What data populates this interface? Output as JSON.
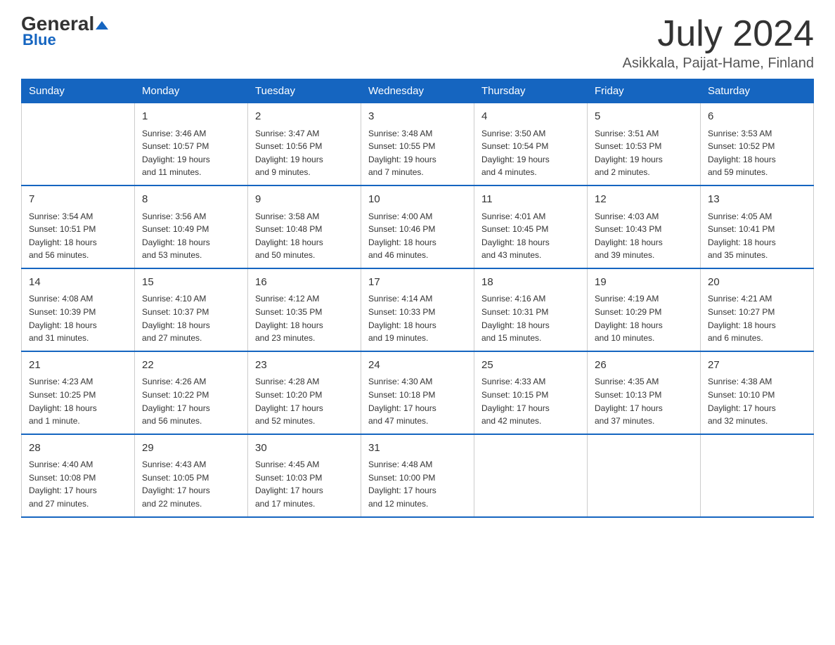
{
  "header": {
    "logo_general": "General",
    "logo_blue": "Blue",
    "month_year": "July 2024",
    "location": "Asikkala, Paijat-Hame, Finland"
  },
  "days_of_week": [
    "Sunday",
    "Monday",
    "Tuesday",
    "Wednesday",
    "Thursday",
    "Friday",
    "Saturday"
  ],
  "weeks": [
    {
      "days": [
        {
          "num": "",
          "info": ""
        },
        {
          "num": "1",
          "info": "Sunrise: 3:46 AM\nSunset: 10:57 PM\nDaylight: 19 hours\nand 11 minutes."
        },
        {
          "num": "2",
          "info": "Sunrise: 3:47 AM\nSunset: 10:56 PM\nDaylight: 19 hours\nand 9 minutes."
        },
        {
          "num": "3",
          "info": "Sunrise: 3:48 AM\nSunset: 10:55 PM\nDaylight: 19 hours\nand 7 minutes."
        },
        {
          "num": "4",
          "info": "Sunrise: 3:50 AM\nSunset: 10:54 PM\nDaylight: 19 hours\nand 4 minutes."
        },
        {
          "num": "5",
          "info": "Sunrise: 3:51 AM\nSunset: 10:53 PM\nDaylight: 19 hours\nand 2 minutes."
        },
        {
          "num": "6",
          "info": "Sunrise: 3:53 AM\nSunset: 10:52 PM\nDaylight: 18 hours\nand 59 minutes."
        }
      ]
    },
    {
      "days": [
        {
          "num": "7",
          "info": "Sunrise: 3:54 AM\nSunset: 10:51 PM\nDaylight: 18 hours\nand 56 minutes."
        },
        {
          "num": "8",
          "info": "Sunrise: 3:56 AM\nSunset: 10:49 PM\nDaylight: 18 hours\nand 53 minutes."
        },
        {
          "num": "9",
          "info": "Sunrise: 3:58 AM\nSunset: 10:48 PM\nDaylight: 18 hours\nand 50 minutes."
        },
        {
          "num": "10",
          "info": "Sunrise: 4:00 AM\nSunset: 10:46 PM\nDaylight: 18 hours\nand 46 minutes."
        },
        {
          "num": "11",
          "info": "Sunrise: 4:01 AM\nSunset: 10:45 PM\nDaylight: 18 hours\nand 43 minutes."
        },
        {
          "num": "12",
          "info": "Sunrise: 4:03 AM\nSunset: 10:43 PM\nDaylight: 18 hours\nand 39 minutes."
        },
        {
          "num": "13",
          "info": "Sunrise: 4:05 AM\nSunset: 10:41 PM\nDaylight: 18 hours\nand 35 minutes."
        }
      ]
    },
    {
      "days": [
        {
          "num": "14",
          "info": "Sunrise: 4:08 AM\nSunset: 10:39 PM\nDaylight: 18 hours\nand 31 minutes."
        },
        {
          "num": "15",
          "info": "Sunrise: 4:10 AM\nSunset: 10:37 PM\nDaylight: 18 hours\nand 27 minutes."
        },
        {
          "num": "16",
          "info": "Sunrise: 4:12 AM\nSunset: 10:35 PM\nDaylight: 18 hours\nand 23 minutes."
        },
        {
          "num": "17",
          "info": "Sunrise: 4:14 AM\nSunset: 10:33 PM\nDaylight: 18 hours\nand 19 minutes."
        },
        {
          "num": "18",
          "info": "Sunrise: 4:16 AM\nSunset: 10:31 PM\nDaylight: 18 hours\nand 15 minutes."
        },
        {
          "num": "19",
          "info": "Sunrise: 4:19 AM\nSunset: 10:29 PM\nDaylight: 18 hours\nand 10 minutes."
        },
        {
          "num": "20",
          "info": "Sunrise: 4:21 AM\nSunset: 10:27 PM\nDaylight: 18 hours\nand 6 minutes."
        }
      ]
    },
    {
      "days": [
        {
          "num": "21",
          "info": "Sunrise: 4:23 AM\nSunset: 10:25 PM\nDaylight: 18 hours\nand 1 minute."
        },
        {
          "num": "22",
          "info": "Sunrise: 4:26 AM\nSunset: 10:22 PM\nDaylight: 17 hours\nand 56 minutes."
        },
        {
          "num": "23",
          "info": "Sunrise: 4:28 AM\nSunset: 10:20 PM\nDaylight: 17 hours\nand 52 minutes."
        },
        {
          "num": "24",
          "info": "Sunrise: 4:30 AM\nSunset: 10:18 PM\nDaylight: 17 hours\nand 47 minutes."
        },
        {
          "num": "25",
          "info": "Sunrise: 4:33 AM\nSunset: 10:15 PM\nDaylight: 17 hours\nand 42 minutes."
        },
        {
          "num": "26",
          "info": "Sunrise: 4:35 AM\nSunset: 10:13 PM\nDaylight: 17 hours\nand 37 minutes."
        },
        {
          "num": "27",
          "info": "Sunrise: 4:38 AM\nSunset: 10:10 PM\nDaylight: 17 hours\nand 32 minutes."
        }
      ]
    },
    {
      "days": [
        {
          "num": "28",
          "info": "Sunrise: 4:40 AM\nSunset: 10:08 PM\nDaylight: 17 hours\nand 27 minutes."
        },
        {
          "num": "29",
          "info": "Sunrise: 4:43 AM\nSunset: 10:05 PM\nDaylight: 17 hours\nand 22 minutes."
        },
        {
          "num": "30",
          "info": "Sunrise: 4:45 AM\nSunset: 10:03 PM\nDaylight: 17 hours\nand 17 minutes."
        },
        {
          "num": "31",
          "info": "Sunrise: 4:48 AM\nSunset: 10:00 PM\nDaylight: 17 hours\nand 12 minutes."
        },
        {
          "num": "",
          "info": ""
        },
        {
          "num": "",
          "info": ""
        },
        {
          "num": "",
          "info": ""
        }
      ]
    }
  ]
}
